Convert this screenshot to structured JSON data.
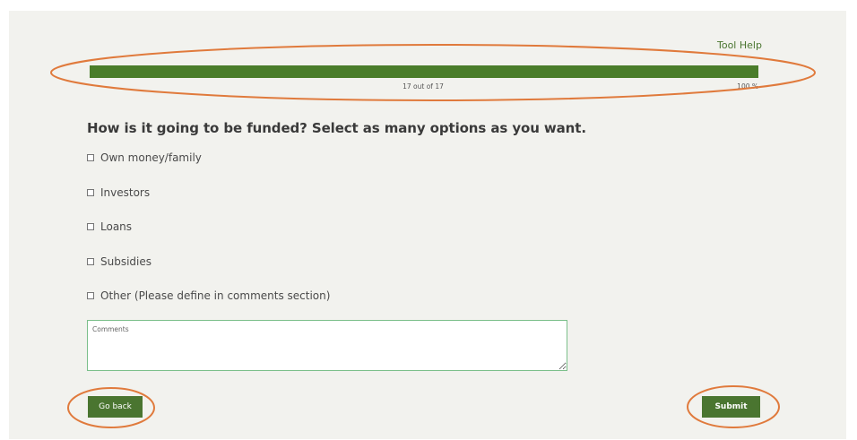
{
  "header": {
    "tool_help": "Tool Help"
  },
  "progress": {
    "count_label": "17 out of 17",
    "percent_label": "100 %",
    "fraction": 1.0
  },
  "question": {
    "title": "How is it going to be funded? Select as many options as you want.",
    "options": [
      {
        "label": "Own money/family",
        "checked": false
      },
      {
        "label": "Investors",
        "checked": false
      },
      {
        "label": "Loans",
        "checked": false
      },
      {
        "label": "Subsidies",
        "checked": false
      },
      {
        "label": "Other (Please define in comments section)",
        "checked": false
      }
    ]
  },
  "comments": {
    "placeholder": "Comments",
    "value": ""
  },
  "actions": {
    "back_label": "Go back",
    "submit_label": "Submit"
  },
  "colors": {
    "accent": "#4a7530",
    "progress_fill": "#4a7d2a",
    "panel_background": "#f2f2ee",
    "annotation": "#e07a3c",
    "field_border": "#7bbf8a"
  }
}
